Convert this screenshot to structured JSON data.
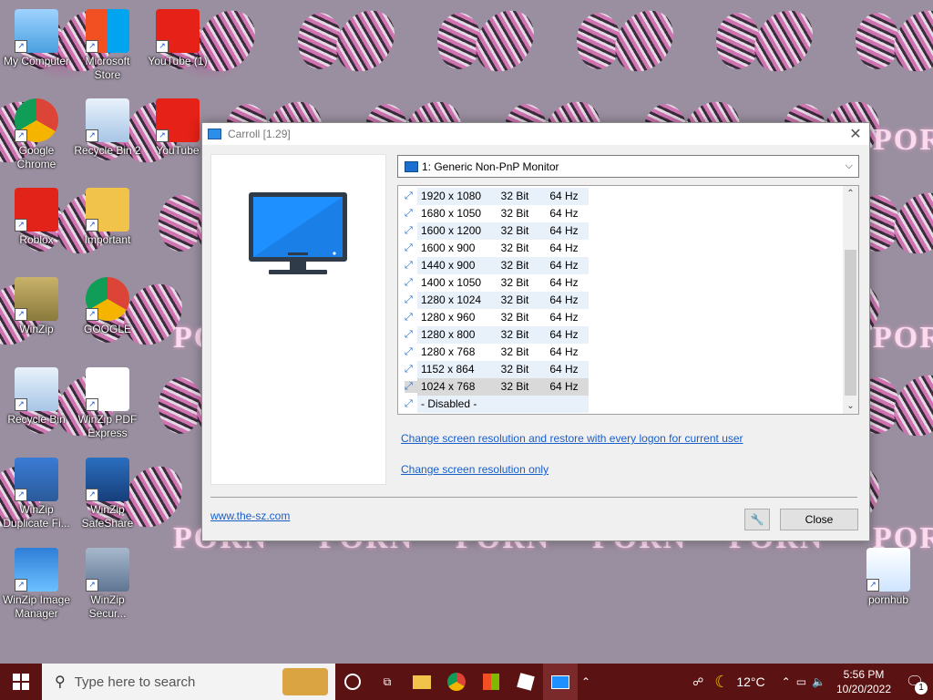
{
  "desktop": {
    "watermark": "PORN",
    "icons": [
      {
        "label": "My Computer",
        "icon": "computer-icon"
      },
      {
        "label": "Microsoft Store",
        "icon": "store-icon"
      },
      {
        "label": "YouTube (1)",
        "icon": "youtube-icon"
      },
      {
        "label": "Google Chrome",
        "icon": "chrome-icon"
      },
      {
        "label": "Recycle Bin 2",
        "icon": "recycle-bin-icon"
      },
      {
        "label": "YouTube",
        "icon": "youtube-icon"
      },
      {
        "label": "Roblox",
        "icon": "roblox-icon"
      },
      {
        "label": "Important",
        "icon": "folder-icon"
      },
      {
        "label": "WinZip",
        "icon": "winzip-icon"
      },
      {
        "label": "GOOGLE",
        "icon": "chrome-icon"
      },
      {
        "label": "Recycle Bin",
        "icon": "recycle-bin-icon"
      },
      {
        "label": "WinZip PDF Express",
        "icon": "pdf-icon"
      },
      {
        "label": "WinZip Duplicate Fi...",
        "icon": "winzip-duplicate-icon"
      },
      {
        "label": "WinZip SafeShare",
        "icon": "share-icon"
      },
      {
        "label": "WinZip Image Manager",
        "icon": "image-manager-icon"
      },
      {
        "label": "WinZip Secur...",
        "icon": "secure-icon"
      },
      {
        "label": "pornhub",
        "icon": "document-icon"
      }
    ]
  },
  "window": {
    "title": "Carroll [1.29]",
    "monitor_select": "1: Generic Non-PnP Monitor",
    "resolutions": [
      {
        "res": "1920 x 1080",
        "bit": "32 Bit",
        "hz": "64 Hz"
      },
      {
        "res": "1680 x 1050",
        "bit": "32 Bit",
        "hz": "64 Hz"
      },
      {
        "res": "1600 x 1200",
        "bit": "32 Bit",
        "hz": "64 Hz"
      },
      {
        "res": "1600 x 900",
        "bit": "32 Bit",
        "hz": "64 Hz"
      },
      {
        "res": "1440 x 900",
        "bit": "32 Bit",
        "hz": "64 Hz"
      },
      {
        "res": "1400 x 1050",
        "bit": "32 Bit",
        "hz": "64 Hz"
      },
      {
        "res": "1280 x 1024",
        "bit": "32 Bit",
        "hz": "64 Hz"
      },
      {
        "res": "1280 x 960",
        "bit": "32 Bit",
        "hz": "64 Hz"
      },
      {
        "res": "1280 x 800",
        "bit": "32 Bit",
        "hz": "64 Hz"
      },
      {
        "res": "1280 x 768",
        "bit": "32 Bit",
        "hz": "64 Hz"
      },
      {
        "res": "1152 x 864",
        "bit": "32 Bit",
        "hz": "64 Hz"
      },
      {
        "res": "1024 x 768",
        "bit": "32 Bit",
        "hz": "64 Hz"
      },
      {
        "res": "- Disabled -",
        "bit": "",
        "hz": ""
      }
    ],
    "selected_resolution": "1024 x 768",
    "link_restore": "Change screen resolution and restore with every logon for current user",
    "link_only": "Change screen resolution only",
    "website": "www.the-sz.com",
    "close_label": "Close"
  },
  "taskbar": {
    "search_placeholder": "Type here to search",
    "weather": "12°C",
    "time": "5:56 PM",
    "date": "10/20/2022",
    "notification_count": "1"
  },
  "colors": {
    "taskbar": "#5a1212",
    "link": "#1a5ec8",
    "monitor_blue": "#1e90ff"
  }
}
